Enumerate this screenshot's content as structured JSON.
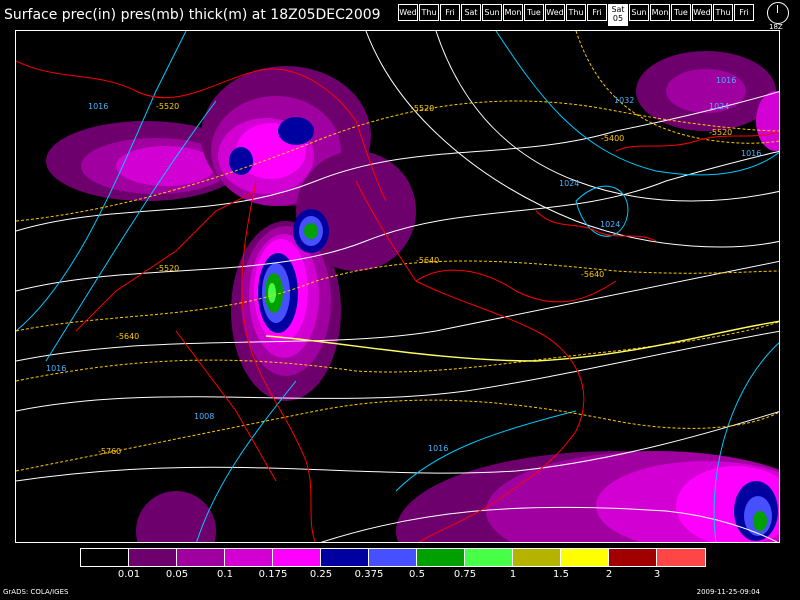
{
  "title": "Surface prec(in) pres(mb) thick(m) at 18Z05DEC2009",
  "days": [
    "Wed",
    "Thu",
    "Fri",
    "Sat",
    "Sun",
    "Mon",
    "Tue",
    "Wed",
    "Thu",
    "Fri",
    "Sat",
    "Sun",
    "Mon",
    "Tue",
    "Wed",
    "Thu",
    "Fri"
  ],
  "selected_day_index": 10,
  "selected_day_number": "05",
  "clock_label": "18Z",
  "pressure_labels": [
    "1016",
    "1032",
    "1024",
    "1024",
    "1024",
    "1016",
    "1016",
    "1008",
    "1016",
    "1016"
  ],
  "thickness_labels": [
    "5520",
    "5520",
    "5520",
    "5400",
    "5520",
    "5640",
    "5640",
    "5640",
    "5760"
  ],
  "colorbar": {
    "colors": [
      "#000000",
      "#6e006e",
      "#a000a0",
      "#d200d2",
      "#ff00ff",
      "#0000a0",
      "#4650ff",
      "#00a000",
      "#46ff46",
      "#b4b400",
      "#ffff00",
      "#a00000",
      "#ff4646"
    ],
    "labels": [
      "0.01",
      "0.05",
      "0.1",
      "0.175",
      "0.25",
      "0.375",
      "0.5",
      "0.75",
      "1",
      "1.5",
      "2",
      "3"
    ]
  },
  "footer_left": "GrADS: COLA/IGES",
  "footer_right": "2009-11-25-09:04"
}
